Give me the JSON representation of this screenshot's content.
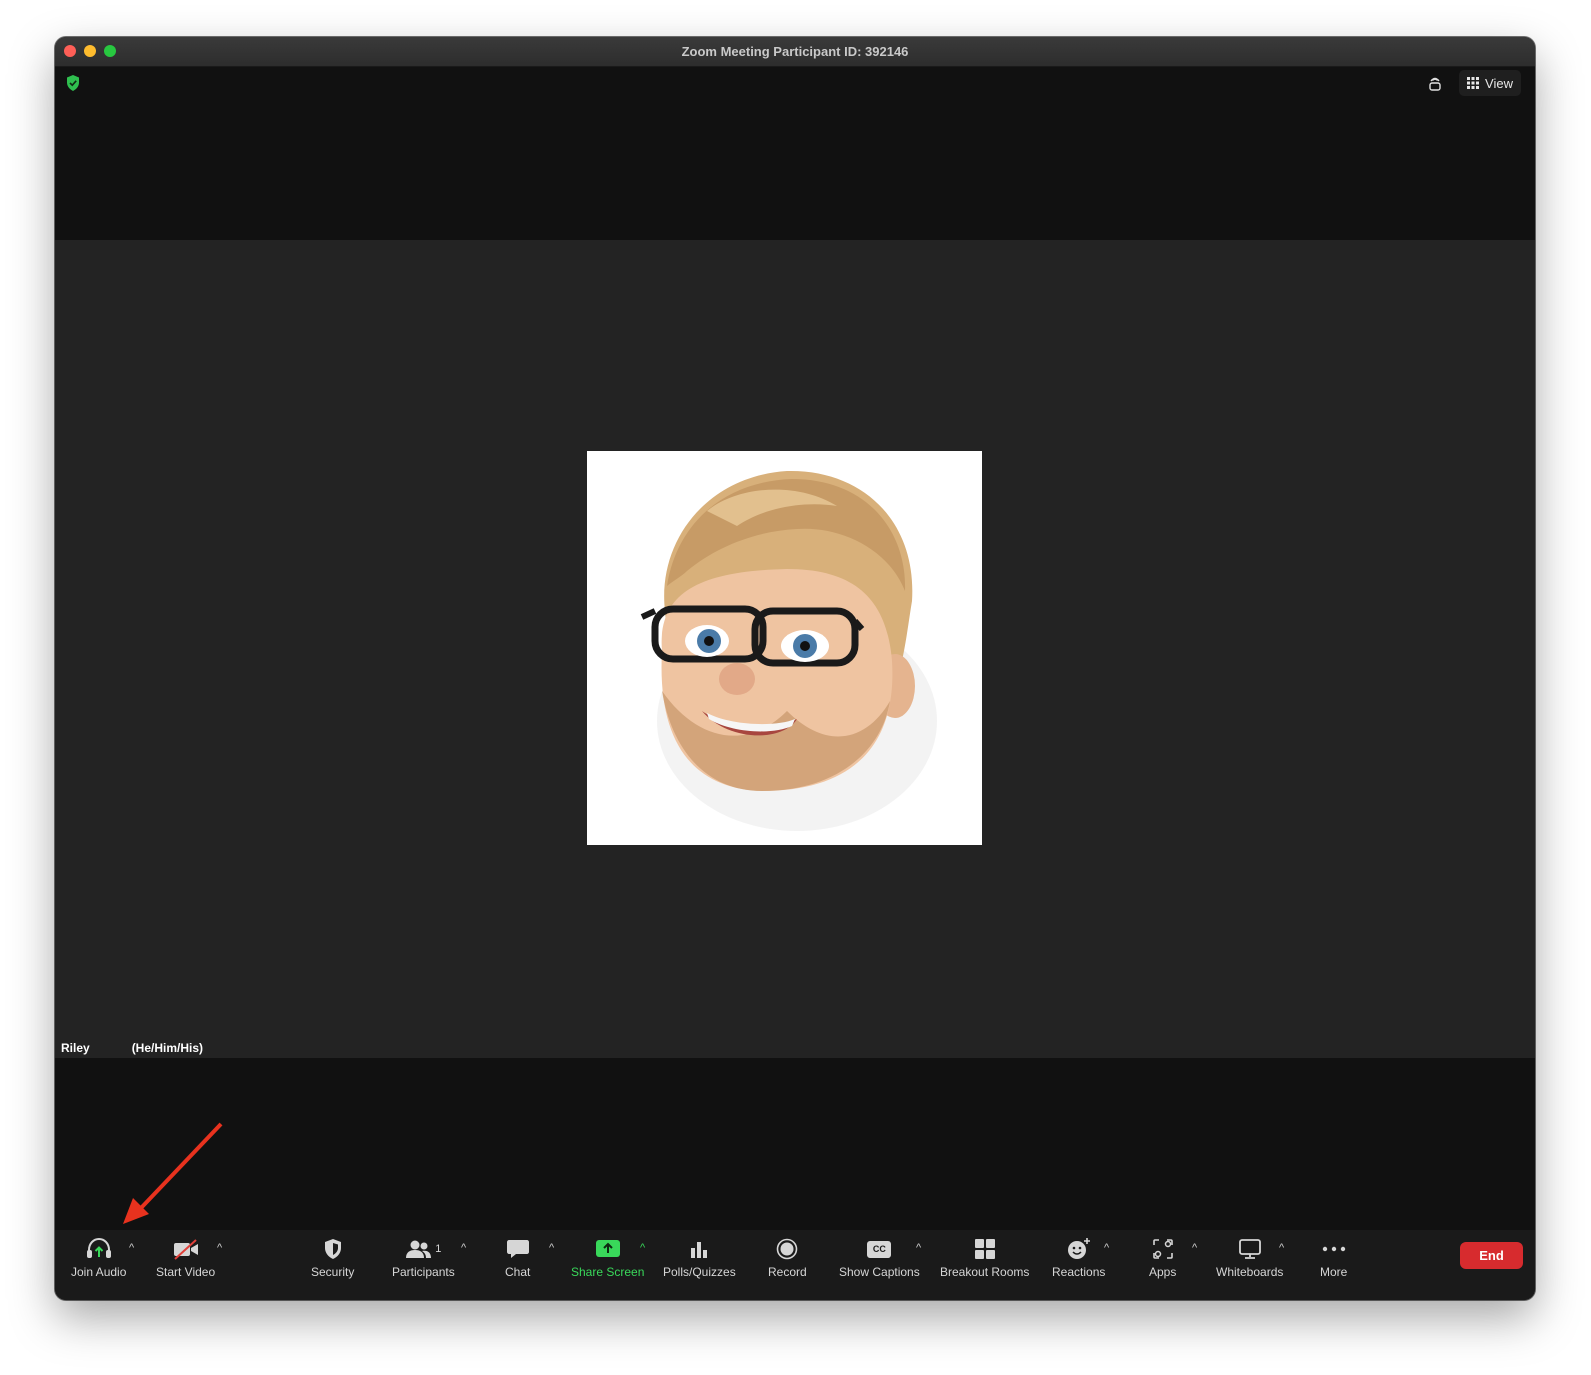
{
  "window": {
    "title": "Zoom Meeting Participant ID: 392146"
  },
  "topbar": {
    "view_label": "View"
  },
  "participant": {
    "first_name": "Riley",
    "pronouns": "(He/Him/His)"
  },
  "toolbar": {
    "join_audio": "Join Audio",
    "start_video": "Start Video",
    "security": "Security",
    "participants": "Participants",
    "participants_count": "1",
    "chat": "Chat",
    "share_screen": "Share Screen",
    "polls": "Polls/Quizzes",
    "record": "Record",
    "show_captions": "Show Captions",
    "breakout_rooms": "Breakout Rooms",
    "reactions": "Reactions",
    "apps": "Apps",
    "whiteboards": "Whiteboards",
    "more": "More",
    "end": "End",
    "captions_badge": "CC"
  },
  "colors": {
    "share_green": "#39d85a",
    "end_red": "#d72b2e",
    "annotation_arrow": "#e8321e"
  },
  "icons": [
    "shield-check-icon",
    "follow-camera-icon",
    "grid-view-icon",
    "headphones-icon",
    "video-off-icon",
    "security-shield-icon",
    "participants-icon",
    "chat-bubble-icon",
    "share-screen-icon",
    "polls-icon",
    "record-icon",
    "captions-icon",
    "breakout-rooms-icon",
    "reactions-icon",
    "apps-icon",
    "whiteboard-icon",
    "more-dots-icon"
  ]
}
